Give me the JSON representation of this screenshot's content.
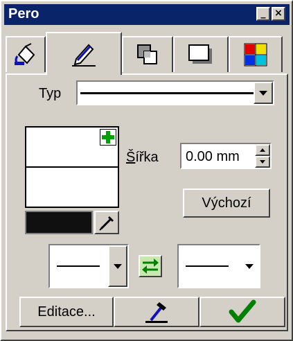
{
  "window": {
    "title": "Pero",
    "minimize_label": "_",
    "close_label": "×"
  },
  "tabs": [
    {
      "name": "fill",
      "icon": "paint-bucket-icon"
    },
    {
      "name": "pen",
      "icon": "pen-icon"
    },
    {
      "name": "transparency",
      "icon": "transparency-icon"
    },
    {
      "name": "shadow",
      "icon": "shadow-icon"
    },
    {
      "name": "colors",
      "icon": "color-grid-icon"
    }
  ],
  "type_row": {
    "label": "Typ",
    "selected": "solid line"
  },
  "width_row": {
    "label": "Šířka",
    "value": "0.00 mm"
  },
  "default_button": {
    "label": "Výchozí"
  },
  "color_swatch": {
    "color": "#101010"
  },
  "line_ends": {
    "start": "plain line",
    "end": "plain line"
  },
  "bottom": {
    "edit_label": "Editace...",
    "eyedropper_icon": "eyedropper-icon",
    "apply_icon": "checkmark-icon"
  },
  "colors": {
    "title_bar": "#0a246a",
    "face": "#d4d0c8",
    "plus": "#00a000",
    "check": "#008000"
  }
}
